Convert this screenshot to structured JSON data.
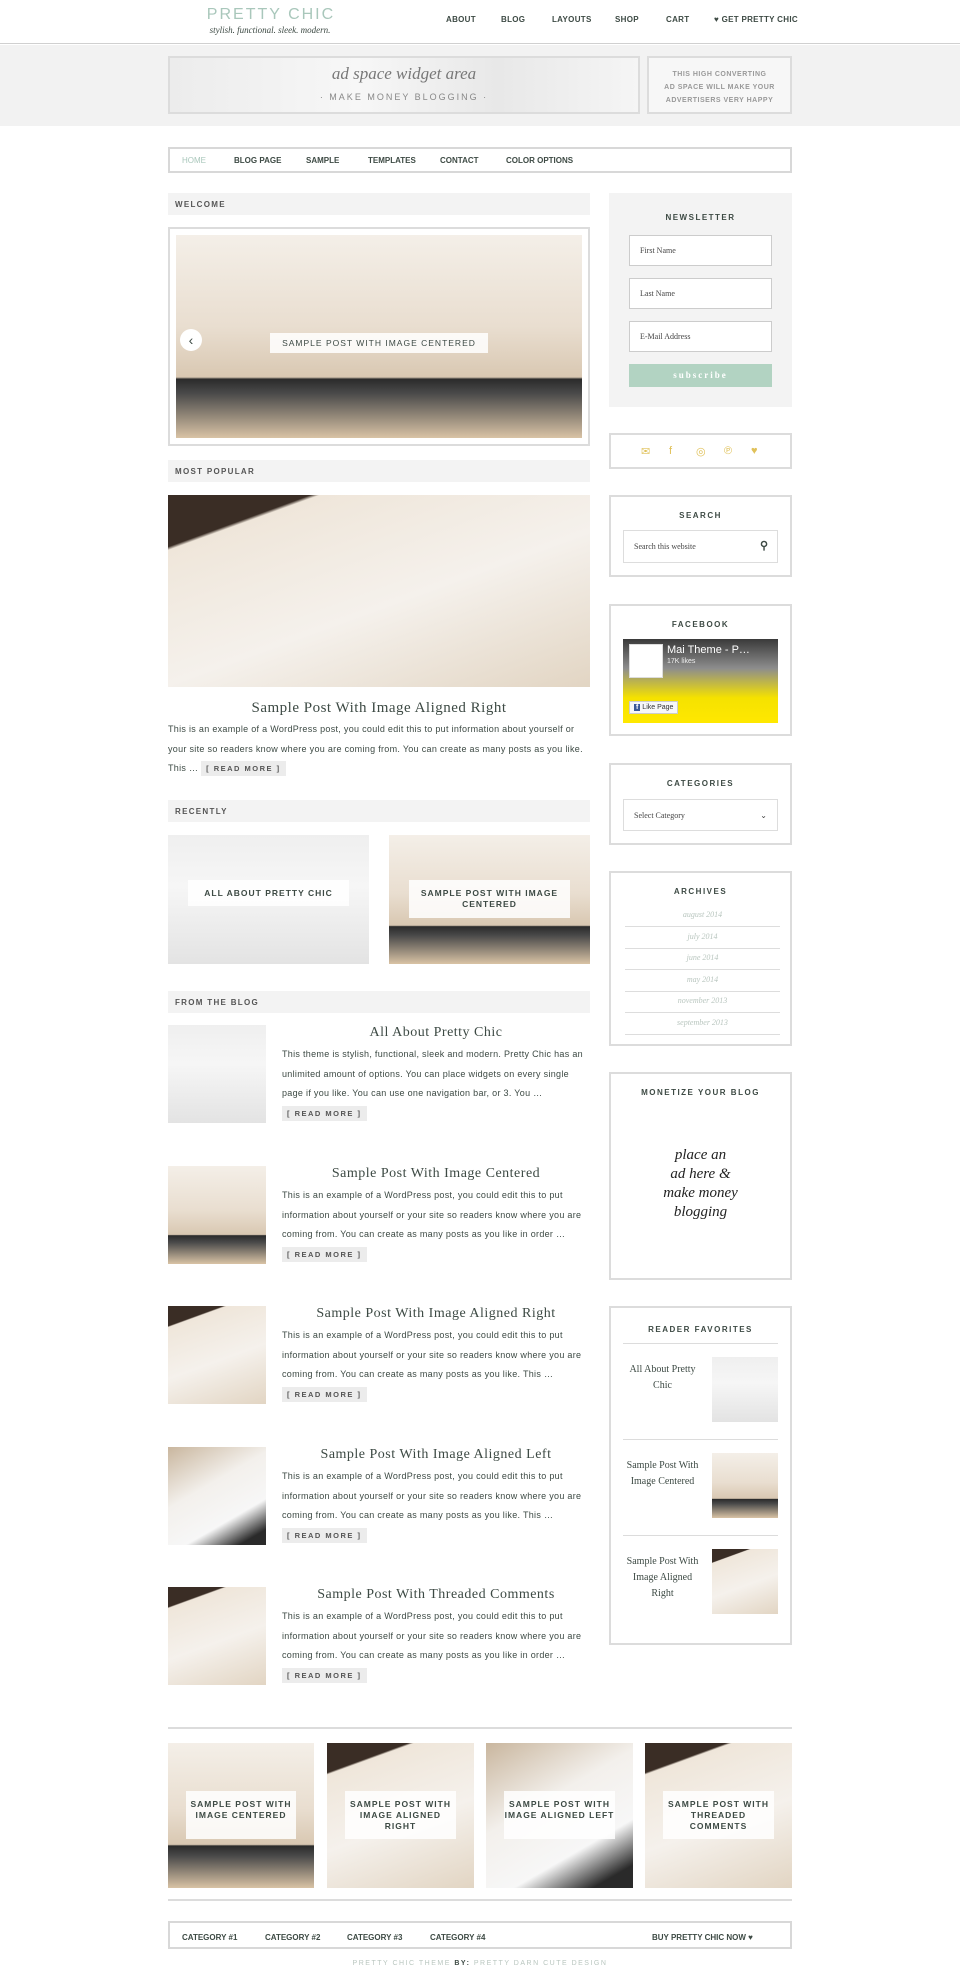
{
  "header": {
    "logo_title": "PRETTY CHIC",
    "logo_tagline": "stylish. functional. sleek. modern.",
    "nav": [
      "ABOUT",
      "BLOG",
      "LAYOUTS",
      "SHOP",
      "CART",
      "♥ GET PRETTY CHIC"
    ]
  },
  "ad_banner": {
    "script": "ad space widget area",
    "subtitle": "· MAKE MONEY BLOGGING ·",
    "side_text": [
      "THIS HIGH CONVERTING",
      "AD SPACE WILL MAKE YOUR",
      "ADVERTISERS VERY HAPPY"
    ]
  },
  "main_nav": {
    "items": [
      "HOME",
      "BLOG PAGE",
      "SAMPLE",
      "TEMPLATES",
      "CONTACT",
      "COLOR OPTIONS"
    ],
    "active": "HOME"
  },
  "welcome": {
    "heading": "WELCOME",
    "slide_caption": "SAMPLE POST WITH IMAGE CENTERED"
  },
  "most_popular": {
    "heading": "MOST POPULAR",
    "title": "Sample Post With Image Aligned Right",
    "excerpt": "This is an example of a WordPress post, you could edit this to put information about yourself or your site so readers know where you are coming from. You can create as many posts as you like. This …",
    "read_more": "[ READ MORE ]"
  },
  "recently": {
    "heading": "RECENTLY",
    "items": [
      "ALL ABOUT PRETTY CHIC",
      "SAMPLE POST WITH IMAGE CENTERED"
    ]
  },
  "from_blog": {
    "heading": "FROM THE BLOG",
    "read_more": "[ READ MORE ]",
    "posts": [
      {
        "title": "All About Pretty Chic",
        "excerpt": "This theme is stylish, functional, sleek and modern. Pretty Chic has an unlimited amount of options. You can place widgets on every single page if you like. You can use one navigation bar, or 3. You …"
      },
      {
        "title": "Sample Post With Image Centered",
        "excerpt": "This is an example of a WordPress post, you could edit this to put information about yourself or your site so readers know where you are coming from. You can create as many posts as you like in order …"
      },
      {
        "title": "Sample Post With Image Aligned Right",
        "excerpt": "This is an example of a WordPress post, you could edit this to put information about yourself or your site so readers know where you are coming from. You can create as many posts as you like. This …"
      },
      {
        "title": "Sample Post With Image Aligned Left",
        "excerpt": "This is an example of a WordPress post, you could edit this to put information about yourself or your site so readers know where you are coming from. You can create as many posts as you like. This …"
      },
      {
        "title": "Sample Post With Threaded Comments",
        "excerpt": "This is an example of a WordPress post, you could edit this to put information about yourself or your site so readers know where you are coming from. You can create as many posts as you like in order …"
      }
    ]
  },
  "sidebar": {
    "newsletter": {
      "title": "NEWSLETTER",
      "first_name": "First Name",
      "last_name": "Last Name",
      "email": "E-Mail Address",
      "subscribe": "subscribe"
    },
    "social_icons": [
      "email-icon",
      "facebook-icon",
      "instagram-icon",
      "pinterest-icon",
      "twitter-icon"
    ],
    "search": {
      "title": "SEARCH",
      "placeholder": "Search this website"
    },
    "facebook": {
      "title": "FACEBOOK",
      "page_name": "Mai Theme - P…",
      "likes": "17K likes",
      "like_button": "Like Page"
    },
    "categories": {
      "title": "CATEGORIES",
      "selected": "Select Category"
    },
    "archives": {
      "title": "ARCHIVES",
      "items": [
        "august 2014",
        "july 2014",
        "june 2014",
        "may 2014",
        "november 2013",
        "september 2013"
      ]
    },
    "monetize": {
      "title": "MONETIZE YOUR BLOG",
      "script": [
        "place an",
        "ad here &",
        "make money",
        "blogging"
      ]
    },
    "reader_favorites": {
      "title": "READER FAVORITES",
      "items": [
        "All About Pretty Chic",
        "Sample Post With Image Centered",
        "Sample Post With Image Aligned Right"
      ]
    }
  },
  "bottom_posts": [
    "SAMPLE POST WITH IMAGE CENTERED",
    "SAMPLE POST WITH IMAGE ALIGNED RIGHT",
    "SAMPLE POST WITH IMAGE ALIGNED LEFT",
    "SAMPLE POST WITH THREADED COMMENTS"
  ],
  "footer_nav": {
    "items": [
      "CATEGORY #1",
      "CATEGORY #2",
      "CATEGORY #3",
      "CATEGORY #4"
    ],
    "buy": "BUY PRETTY CHIC NOW ♥"
  },
  "credit": {
    "theme": "PRETTY CHIC THEME",
    "by": "BY:",
    "designer": "PRETTY DARN CUTE DESIGN"
  },
  "colors": {
    "accent": "#a9c7bb",
    "subscribe": "#b2d3c2",
    "social": "#e0c15a",
    "text": "#3d4a44"
  }
}
